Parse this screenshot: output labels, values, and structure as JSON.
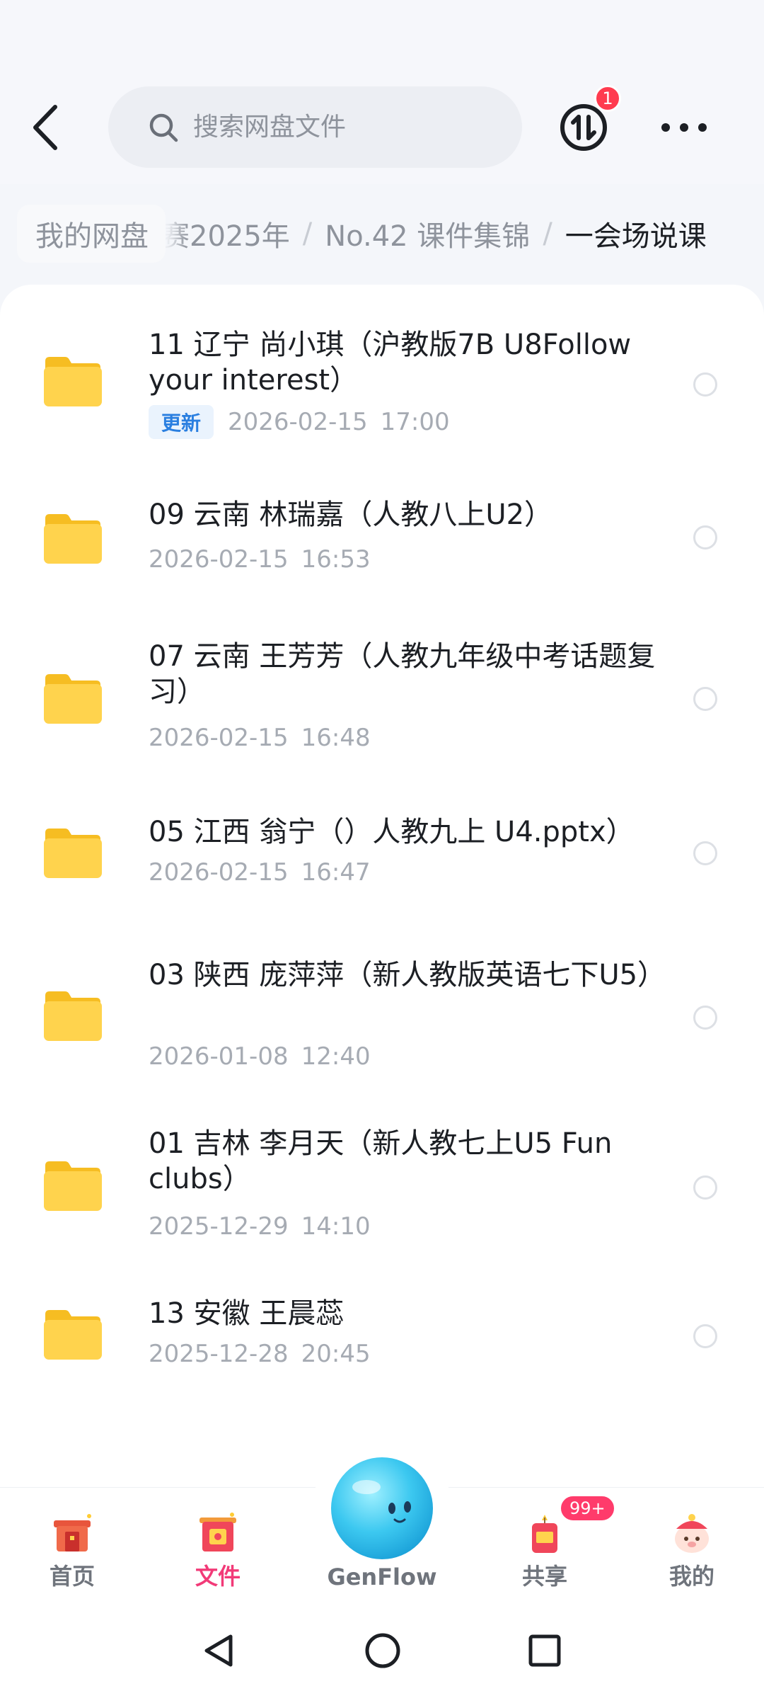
{
  "header": {
    "search_placeholder": "搜索网盘文件",
    "transfer_badge": "1"
  },
  "breadcrumb": {
    "root": "我的网盘",
    "items": [
      "赛2025年",
      "No.42 课件集锦"
    ],
    "current": "一会场说课",
    "separator": "/"
  },
  "files": [
    {
      "name": "11 辽宁 尚小琪（沪教版7B U8Follow your interest）",
      "tag": "更新",
      "date": "2026-02-15",
      "time": "17:00"
    },
    {
      "name": "09 云南  林瑞嘉（人教八上U2）",
      "date": "2026-02-15",
      "time": "16:53"
    },
    {
      "name": "07 云南 王芳芳（人教九年级中考话题复习）",
      "date": "2026-02-15",
      "time": "16:48"
    },
    {
      "name": "05 江西 翁宁（）人教九上 U4.pptx）",
      "date": "2026-02-15",
      "time": "16:47"
    },
    {
      "name": "03 陕西 庞萍萍（新人教版英语七下U5）",
      "date": "2026-01-08",
      "time": "12:40"
    },
    {
      "name": "01 吉林 李月天（新人教七上U5 Fun clubs）",
      "date": "2025-12-29",
      "time": "14:10"
    },
    {
      "name": "13 安徽 王晨蕊",
      "date": "2025-12-28",
      "time": "20:45"
    }
  ],
  "bottom_nav": {
    "home": "首页",
    "files": "文件",
    "genflow": "GenFlow",
    "share": "共享",
    "share_badge": "99+",
    "mine": "我的"
  },
  "colors": {
    "accent": "#f23a78",
    "folder": "#ffd34d",
    "update_tag": "#2a7fe0",
    "badge": "#ff3b4f"
  }
}
